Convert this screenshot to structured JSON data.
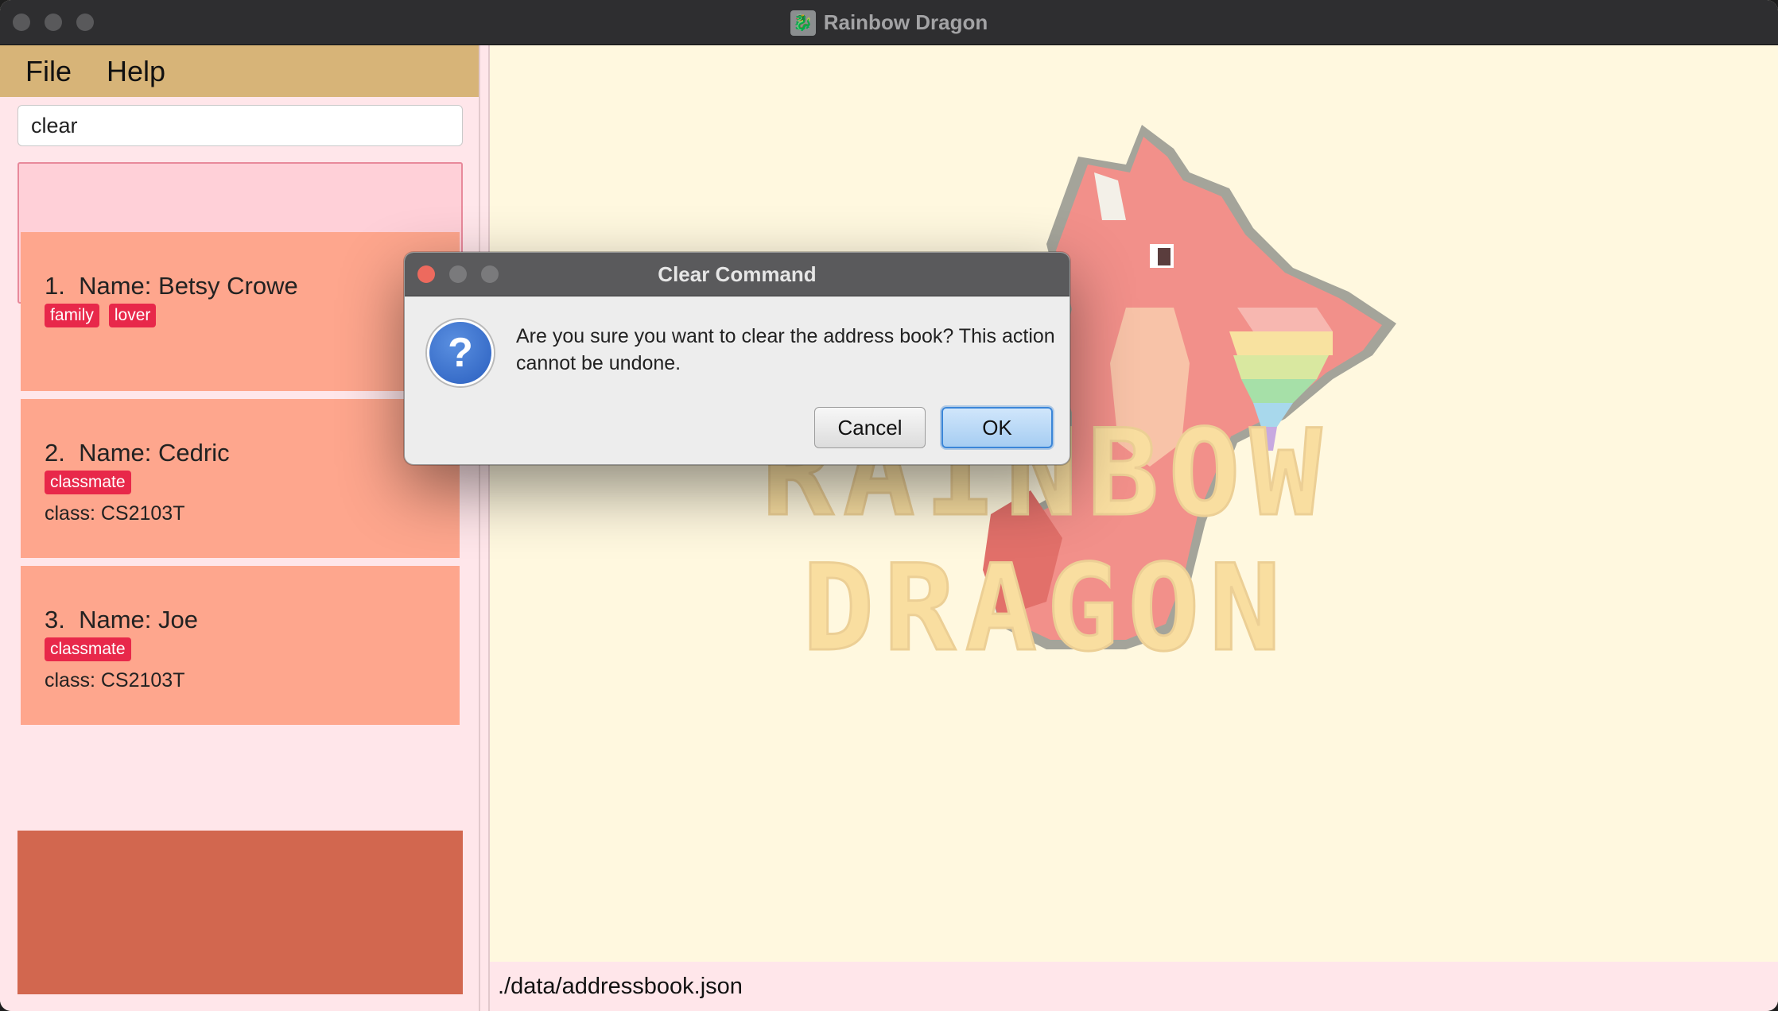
{
  "window": {
    "title": "Rainbow Dragon"
  },
  "menubar": {
    "file": "File",
    "help": "Help"
  },
  "command": {
    "value": "clear"
  },
  "persons": [
    {
      "index": "1.",
      "name": "Name: Betsy Crowe",
      "tags": [
        "family",
        "lover"
      ],
      "class": ""
    },
    {
      "index": "2.",
      "name": "Name: Cedric",
      "tags": [
        "classmate"
      ],
      "class": "class: CS2103T"
    },
    {
      "index": "3.",
      "name": "Name: Joe",
      "tags": [
        "classmate"
      ],
      "class": "class: CS2103T"
    }
  ],
  "logo": {
    "line1": "RAINBOW",
    "line2": "DRAGON"
  },
  "status": {
    "path": "./data/addressbook.json"
  },
  "dialog": {
    "title": "Clear Command",
    "message": "Are you sure you want to clear the address book? This action cannot be undone.",
    "cancel": "Cancel",
    "ok": "OK",
    "icon": "question-icon"
  },
  "colors": {
    "menubar": "#d7b478",
    "card": "#fea68d",
    "tag": "#e8284a",
    "panel": "#ffe6ea",
    "background": "#fff8df"
  }
}
